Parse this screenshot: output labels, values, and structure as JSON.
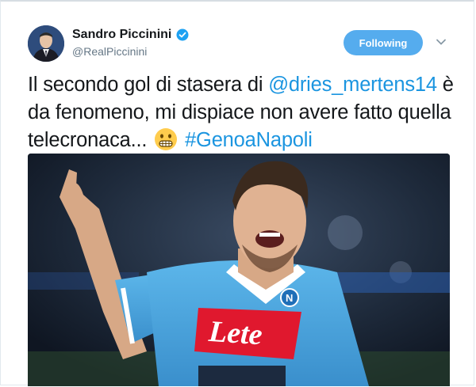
{
  "header": {
    "name": "Sandro Piccinini",
    "handle": "@RealPiccinini",
    "follow_label": "Following"
  },
  "icons": {
    "verified": "verified-badge-icon",
    "caret": "chevron-down-icon",
    "emoji": "grimacing-face-emoji"
  },
  "tweet": {
    "text_1": "Il secondo gol di stasera di ",
    "mention": "@dries_mertens14",
    "text_2": " è da fenomeno, mi dispiace non avere fatto quella telecronaca... ",
    "hashtag": "#GenoaNapoli"
  },
  "photo": {
    "jersey_logo": "Lete"
  },
  "colors": {
    "accent": "#1b95e0",
    "button": "#55acee",
    "jersey": "#4aa6dc"
  }
}
